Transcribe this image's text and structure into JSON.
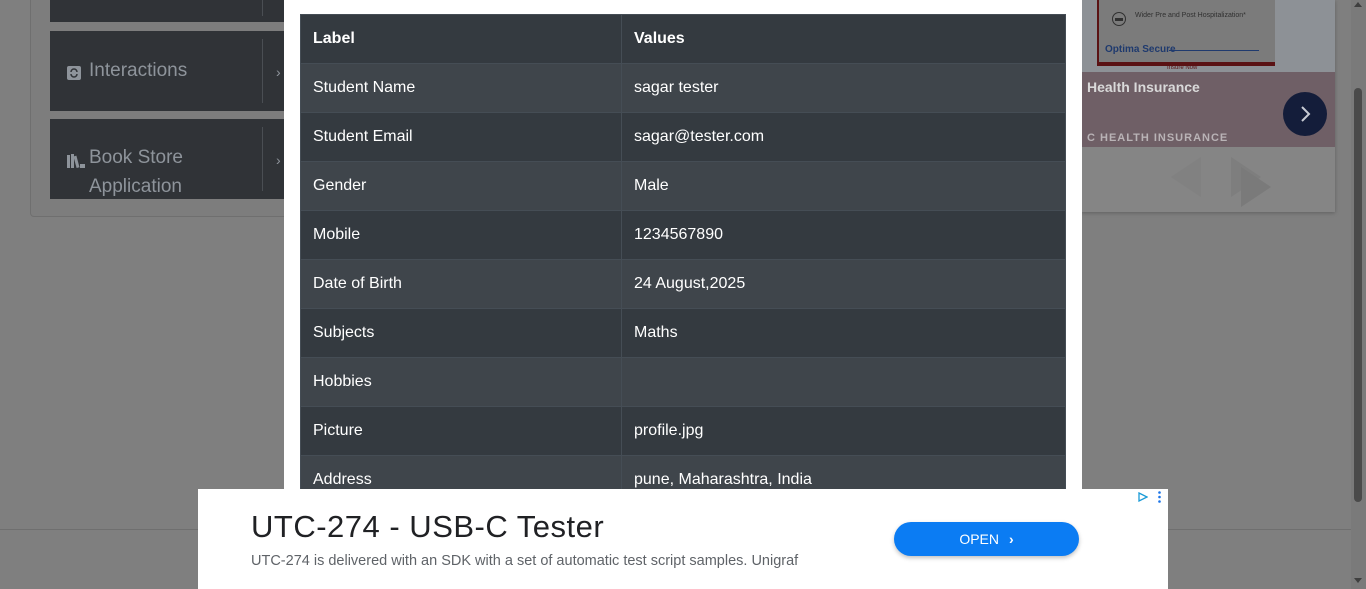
{
  "sidebar": {
    "groups": [
      {
        "label": "Interactions",
        "icon": "interactions-icon"
      },
      {
        "label": "Book Store Application",
        "icon": "book-store-icon"
      }
    ]
  },
  "right_ad": {
    "feature_text": "Wider Pre and Post Hospitalization*",
    "brand": "Optima Secure",
    "insure_now": "Insure Now",
    "title": "Health Insurance",
    "subtitle": "C HEALTH INSURANCE"
  },
  "results_table": {
    "headers": [
      "Label",
      "Values"
    ],
    "rows": [
      {
        "label": "Student Name",
        "value": "sagar tester"
      },
      {
        "label": "Student Email",
        "value": "sagar@tester.com"
      },
      {
        "label": "Gender",
        "value": "Male"
      },
      {
        "label": "Mobile",
        "value": "1234567890"
      },
      {
        "label": "Date of Birth",
        "value": "24 August,2025"
      },
      {
        "label": "Subjects",
        "value": "Maths"
      },
      {
        "label": "Hobbies",
        "value": ""
      },
      {
        "label": "Picture",
        "value": "profile.jpg"
      },
      {
        "label": "Address",
        "value": "pune, Maharashtra, India"
      }
    ]
  },
  "bottom_ad": {
    "headline": "UTC-274 - USB-C Tester",
    "description": "UTC-274 is delivered with an SDK with a set of automatic test script samples. Unigraf",
    "button_label": "OPEN"
  },
  "colors": {
    "table_header_bg": "#343a40",
    "table_row_alt_bg": "#3f454b",
    "open_button": "#0b7cf3"
  }
}
